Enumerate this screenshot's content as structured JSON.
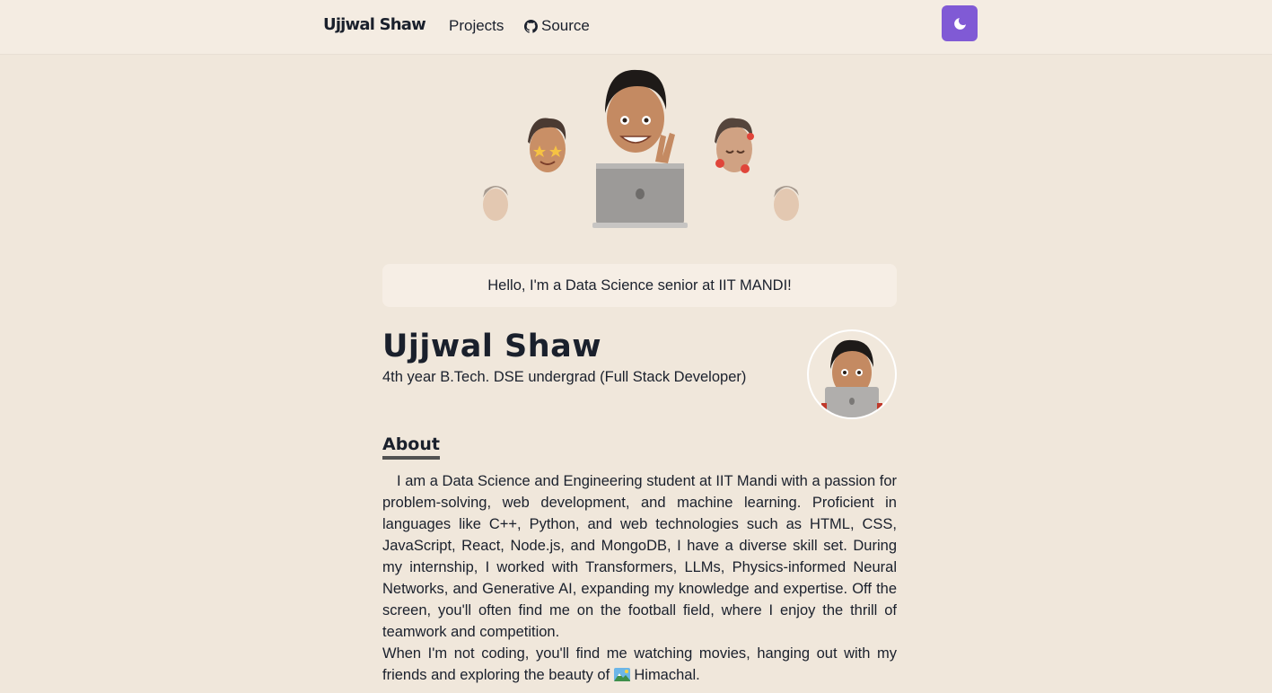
{
  "nav": {
    "brand": "Ujjwal Shaw",
    "projects_label": "Projects",
    "source_label": "Source",
    "source_icon": "github-icon",
    "theme_toggle_icon": "moon-icon",
    "accent_color": "#805ad5"
  },
  "greeting": "Hello, I'm a Data Science senior at IIT MANDI!",
  "profile": {
    "name": "Ujjwal Shaw",
    "subtitle": "4th year B.Tech. DSE undergrad (Full Stack Developer)"
  },
  "about": {
    "heading": "About",
    "paragraph1": "I am a Data Science and Engineering student at IIT Mandi with a passion for problem-solving, web development, and machine learning. Proficient in languages like C++, Python, and web technologies such as HTML, CSS, JavaScript, React, Node.js, and MongoDB, I have a diverse skill set. During my internship, I worked with Transformers, LLMs, Physics-informed Neural Networks, and Generative AI, expanding my knowledge and expertise. Off the screen, you'll often find me on the football field, where I enjoy the thrill of teamwork and competition.",
    "paragraph2_prefix": "When I'm not coding, you'll find me watching movies, hanging out with my friends and exploring the beauty of",
    "paragraph2_suffix": "Himachal.",
    "emoji_icon": "mountain-landscape-icon"
  },
  "colors": {
    "background": "#f0e7db",
    "navbar": "#f4ece2",
    "text": "#1a202c"
  }
}
